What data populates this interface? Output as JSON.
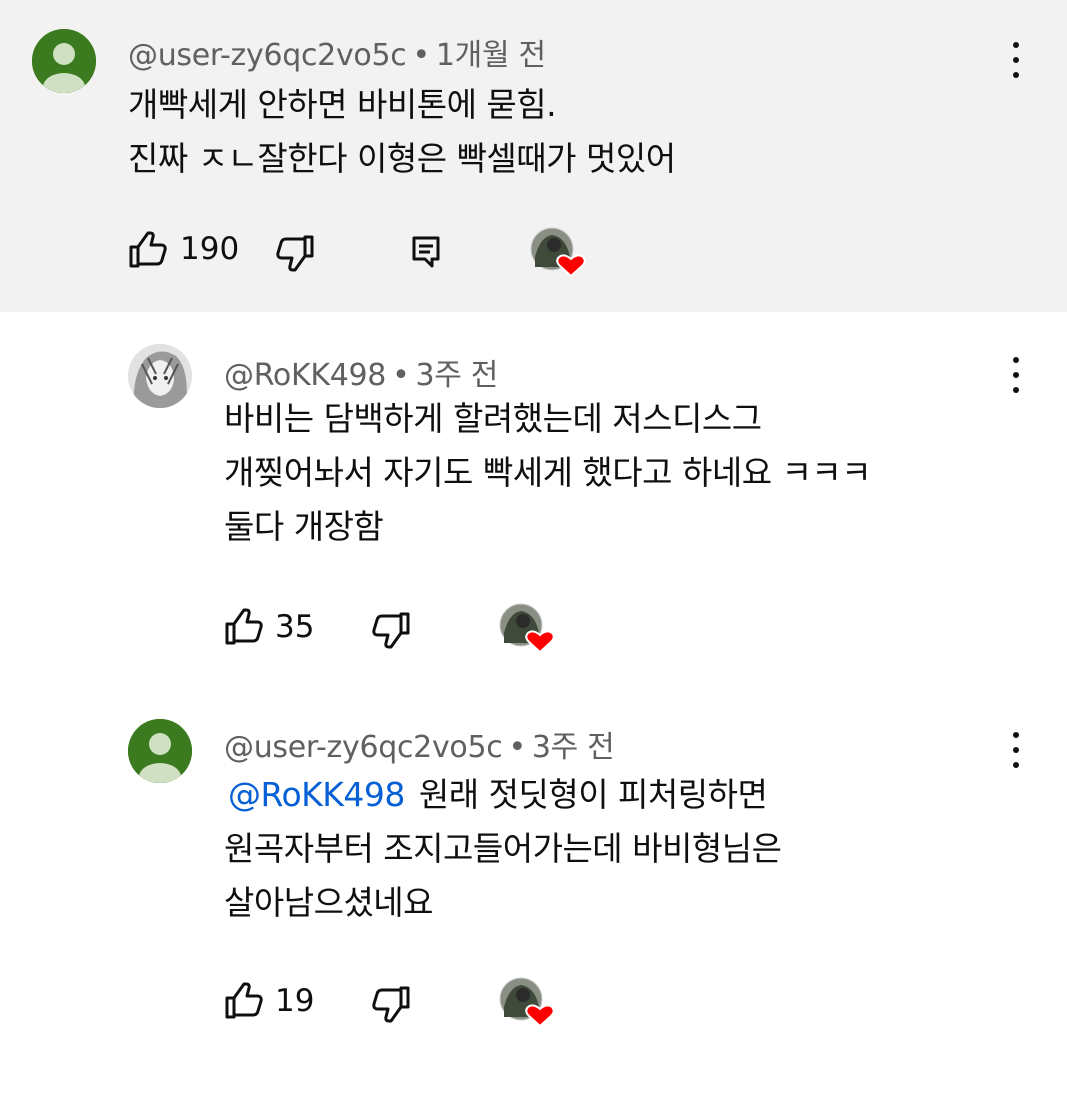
{
  "comments": [
    {
      "author": "@user-zy6qc2vo5c",
      "separator": "•",
      "time": "1개월 전",
      "lines": [
        "개빡세게 안하면 바비톤에 묻힘.",
        "진짜 ㅈㄴ잘한다 이형은 빡셀때가 멋있어"
      ],
      "likes": "190"
    },
    {
      "author": "@RoKK498",
      "separator": "•",
      "time": "3주 전",
      "lines": [
        "바비는 담백하게 할려했는데 저스디스그",
        "개찢어놔서 자기도 빡세게 했다고 하네요 ㅋㅋㅋ",
        "둘다 개장함"
      ],
      "likes": "35"
    },
    {
      "author": "@user-zy6qc2vo5c",
      "separator": "•",
      "time": "3주 전",
      "mention": "@RoKK498",
      "lines": [
        "원래 젓딧형이 피처링하면",
        "원곡자부터 조지고들어가는데 바비형님은",
        "살아남으셨네요"
      ],
      "likes": "19"
    }
  ],
  "colors": {
    "highlight_bg": "#f2f2f2",
    "meta_text": "#606060",
    "mention": "#065fd4",
    "avatar_green": "#3b7a1e",
    "heart": "#ff0000"
  },
  "icons": {
    "like": "thumb-up-icon",
    "dislike": "thumb-down-icon",
    "reply": "reply-icon",
    "more": "more-vert-icon",
    "creator_heart": "heart-icon"
  }
}
